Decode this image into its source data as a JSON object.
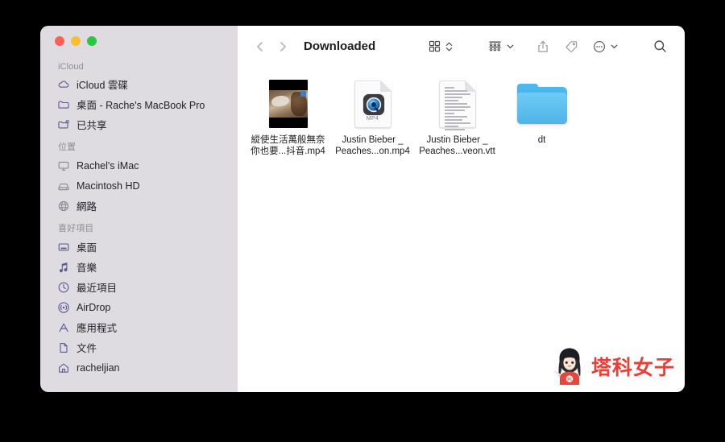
{
  "window": {
    "title": "Downloaded",
    "traffic_lights": [
      {
        "name": "close",
        "color": "#ff5f57"
      },
      {
        "name": "minimize",
        "color": "#febc2e"
      },
      {
        "name": "maximize",
        "color": "#28c840"
      }
    ]
  },
  "toolbar": {
    "back_icon": "chevron-left-icon",
    "forward_icon": "chevron-right-icon",
    "title": "Downloaded",
    "view_mode_icon": "grid-view-icon",
    "view_mode_chevron": "chevron-updown-icon",
    "group_by_icon": "group-by-icon",
    "group_by_chevron": "chevron-down-icon",
    "share_icon": "share-icon",
    "tags_icon": "tag-icon",
    "more_icon": "more-ellipsis-icon",
    "more_chevron": "chevron-down-icon",
    "search_icon": "search-icon"
  },
  "sidebar": {
    "sections": [
      {
        "title": "iCloud",
        "items": [
          {
            "label": "iCloud 雲碟",
            "icon": "icloud-drive-icon"
          },
          {
            "label": "桌面 - Rache's MacBook Pro",
            "icon": "folder-icon"
          },
          {
            "label": "已共享",
            "icon": "shared-folder-icon"
          }
        ]
      },
      {
        "title": "位置",
        "items": [
          {
            "label": "Rachel's iMac",
            "icon": "display-icon"
          },
          {
            "label": "Macintosh HD",
            "icon": "harddisk-icon"
          },
          {
            "label": "網路",
            "icon": "network-globe-icon"
          }
        ]
      },
      {
        "title": "喜好項目",
        "items": [
          {
            "label": "桌面",
            "icon": "desktop-icon"
          },
          {
            "label": "音樂",
            "icon": "music-note-icon"
          },
          {
            "label": "最近項目",
            "icon": "clock-icon"
          },
          {
            "label": "AirDrop",
            "icon": "airdrop-icon"
          },
          {
            "label": "應用程式",
            "icon": "applications-icon"
          },
          {
            "label": "文件",
            "icon": "document-icon"
          },
          {
            "label": "racheljian",
            "icon": "home-icon"
          }
        ]
      }
    ]
  },
  "files": [
    {
      "name": "縱使生活萬般無奈你也要...抖音.mp4",
      "kind": "video-thumbnail",
      "icon": "video-preview-icon"
    },
    {
      "name": "Justin Bieber _ Peaches...on.mp4",
      "kind": "mp4-document",
      "icon": "quicktime-mp4-icon",
      "badge_text": "MP4"
    },
    {
      "name": "Justin Bieber _ Peaches...veon.vtt",
      "kind": "text-document",
      "icon": "text-document-icon"
    },
    {
      "name": "dt",
      "kind": "folder",
      "icon": "blue-folder-icon"
    }
  ],
  "watermark": {
    "text": "塔科女子",
    "badge": "3C",
    "color": "#ef3d36",
    "icon": "mascot-girl-icon"
  },
  "colors": {
    "desktop_background": "#000000",
    "sidebar_background": "#dedce1",
    "content_background": "#ffffff",
    "sidebar_icon": "#5c5a8f",
    "folder_blue": "#4db8ec"
  }
}
